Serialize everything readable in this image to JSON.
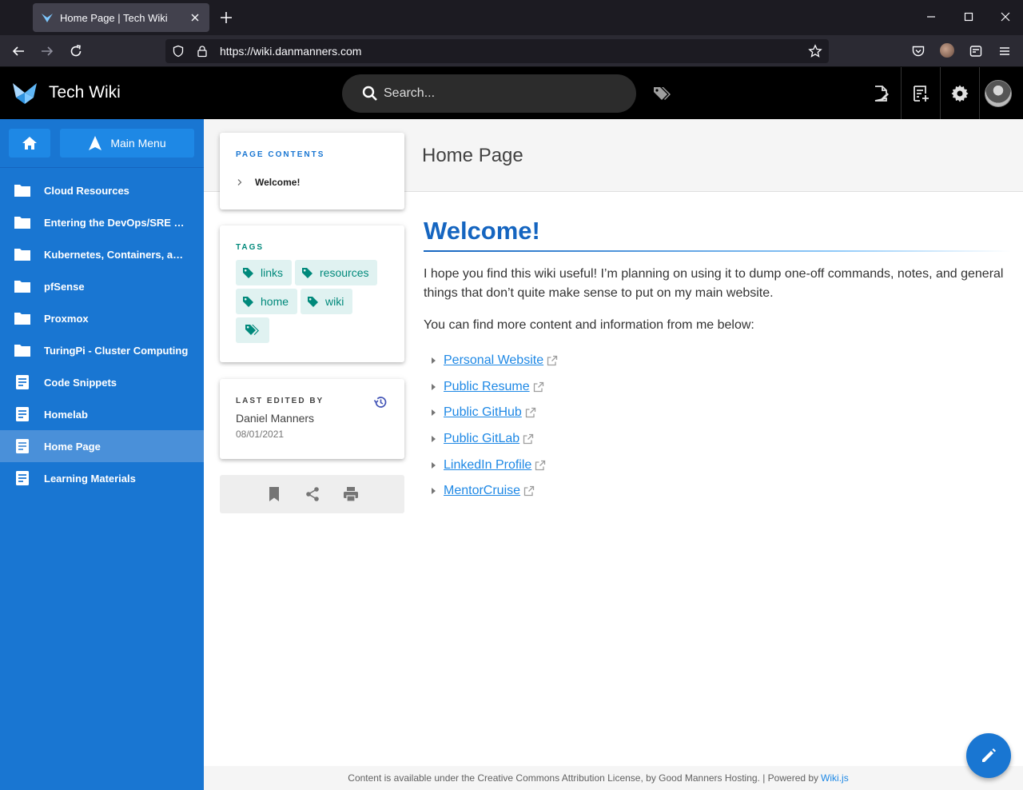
{
  "browser": {
    "tab_title": "Home Page | Tech Wiki",
    "url": "https://wiki.danmanners.com"
  },
  "header": {
    "site_title": "Tech Wiki",
    "search_placeholder": "Search..."
  },
  "sidebar": {
    "main_menu_label": "Main Menu",
    "items": [
      {
        "label": "Cloud Resources",
        "icon": "folder-icon"
      },
      {
        "label": "Entering the DevOps/SRE Space",
        "icon": "folder-icon"
      },
      {
        "label": "Kubernetes, Containers, and Orchestration",
        "icon": "folder-icon"
      },
      {
        "label": "pfSense",
        "icon": "folder-icon"
      },
      {
        "label": "Proxmox",
        "icon": "folder-icon"
      },
      {
        "label": "TuringPi - Cluster Computing",
        "icon": "folder-icon"
      },
      {
        "label": "Code Snippets",
        "icon": "page-icon"
      },
      {
        "label": "Homelab",
        "icon": "page-icon"
      },
      {
        "label": "Home Page",
        "icon": "page-icon",
        "active": true
      },
      {
        "label": "Learning Materials",
        "icon": "page-icon"
      }
    ]
  },
  "page": {
    "title": "Home Page",
    "toc_label": "PAGE CONTENTS",
    "toc_items": [
      "Welcome!"
    ],
    "tags_label": "TAGS",
    "tags": [
      "links",
      "resources",
      "home",
      "wiki"
    ],
    "last_edited_label": "LAST EDITED BY",
    "last_edited_by": "Daniel Manners",
    "last_edited_date": "08/01/2021"
  },
  "content": {
    "heading": "Welcome!",
    "paragraph1": "I hope you find this wiki useful! I’m planning on using it to dump one-off commands, notes, and general things that don’t quite make sense to put on my main website.",
    "paragraph2": "You can find more content and information from me below:",
    "links": [
      "Personal Website",
      "Public Resume",
      "Public GitHub",
      "Public GitLab",
      "LinkedIn Profile",
      "MentorCruise"
    ]
  },
  "footer": {
    "text": "Content is available under the Creative Commons Attribution License, by Good Manners Hosting. | Powered by",
    "link": "Wiki.js"
  },
  "colors": {
    "sidebar": "#1976d2",
    "accent": "#1565c0",
    "tag": "#00897b"
  }
}
